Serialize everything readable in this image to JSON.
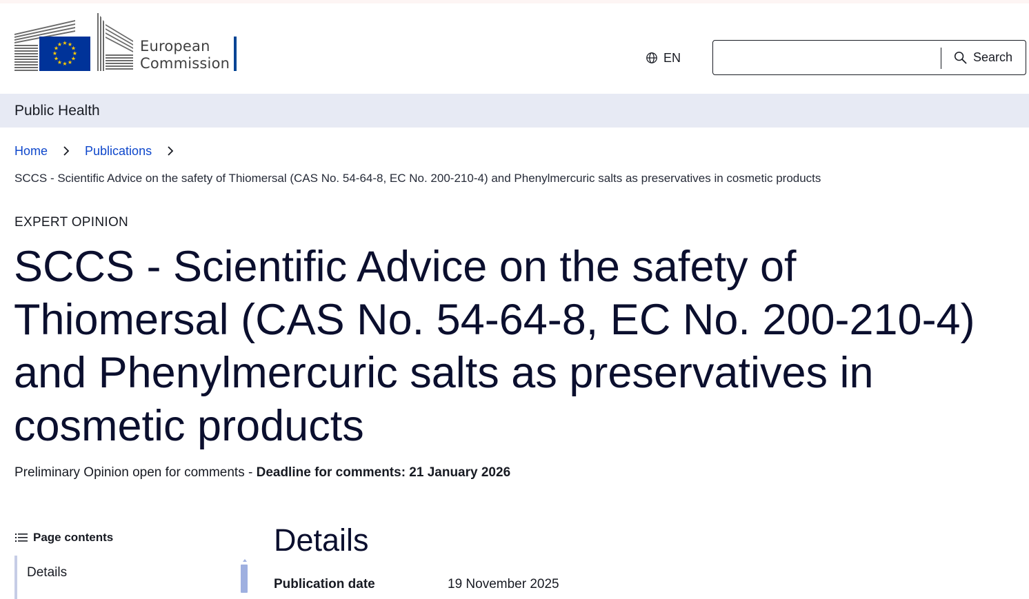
{
  "header": {
    "logo": {
      "line1": "European",
      "line2": "Commission",
      "flag_color": "#003399",
      "star_color": "#ffcc00"
    },
    "language": {
      "code": "EN",
      "icon": "globe-icon"
    },
    "search": {
      "placeholder": "",
      "value": "",
      "button_label": "Search",
      "icon": "search-icon"
    }
  },
  "site": {
    "name": "Public Health"
  },
  "breadcrumb": {
    "items": [
      {
        "label": "Home"
      },
      {
        "label": "Publications"
      }
    ],
    "current": "SCCS - Scientific Advice on the safety of Thiomersal (CAS No. 54-64-8, EC No. 200-210-4) and Phenylmercuric salts as preservatives in cosmetic products"
  },
  "page": {
    "meta": "EXPERT OPINION",
    "title": "SCCS - Scientific Advice on the safety of Thiomersal (CAS No. 54-64-8, EC No. 200-210-4) and Phenylmercuric salts as preservatives in cosmetic products",
    "description_prefix": "Preliminary Opinion open for comments - ",
    "description_bold": "Deadline for comments: 21 January 2026"
  },
  "page_contents": {
    "title": "Page contents",
    "icon": "list-icon",
    "items": [
      {
        "label": "Details"
      }
    ]
  },
  "details": {
    "heading": "Details",
    "rows": [
      {
        "label": "Publication date",
        "value": "19 November 2025"
      }
    ]
  },
  "colors": {
    "link": "#0e47cb",
    "site_band": "#e7eaf4",
    "title": "#0b0f2e",
    "accent_bar": "#004494"
  }
}
